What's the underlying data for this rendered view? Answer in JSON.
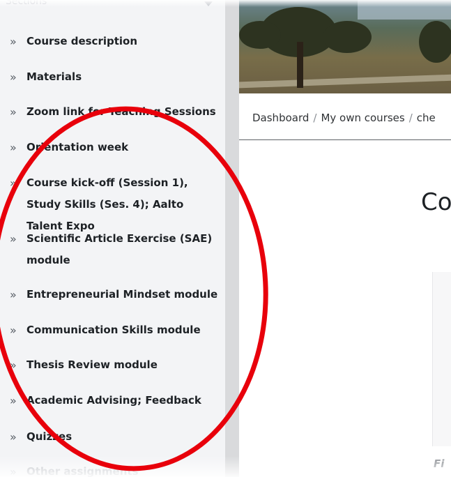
{
  "sidebar": {
    "header": "Sections",
    "items": [
      {
        "label": "Course description"
      },
      {
        "label": "Materials"
      },
      {
        "label": "Zoom link for Teaching Sessions"
      },
      {
        "label": "Orientation week"
      },
      {
        "label": "Course kick-off (Session 1), Study Skills (Ses. 4); Aalto Talent Expo"
      },
      {
        "label": "Scientific Article Exercise (SAE) module"
      },
      {
        "label": "Entrepreneurial Mindset module"
      },
      {
        "label": "Communication Skills module"
      },
      {
        "label": "Thesis Review module"
      },
      {
        "label": "Academic Advising; Feedback"
      },
      {
        "label": "Quizzes"
      },
      {
        "label": "Other assignments"
      }
    ],
    "chevron": "»"
  },
  "breadcrumb": {
    "items": [
      "Dashboard",
      "My own courses",
      "che"
    ],
    "separator": "/"
  },
  "main": {
    "title": "Co",
    "caption_fragment": "Fi"
  },
  "annotation": {
    "shape": "ellipse",
    "color": "#e8000b"
  }
}
